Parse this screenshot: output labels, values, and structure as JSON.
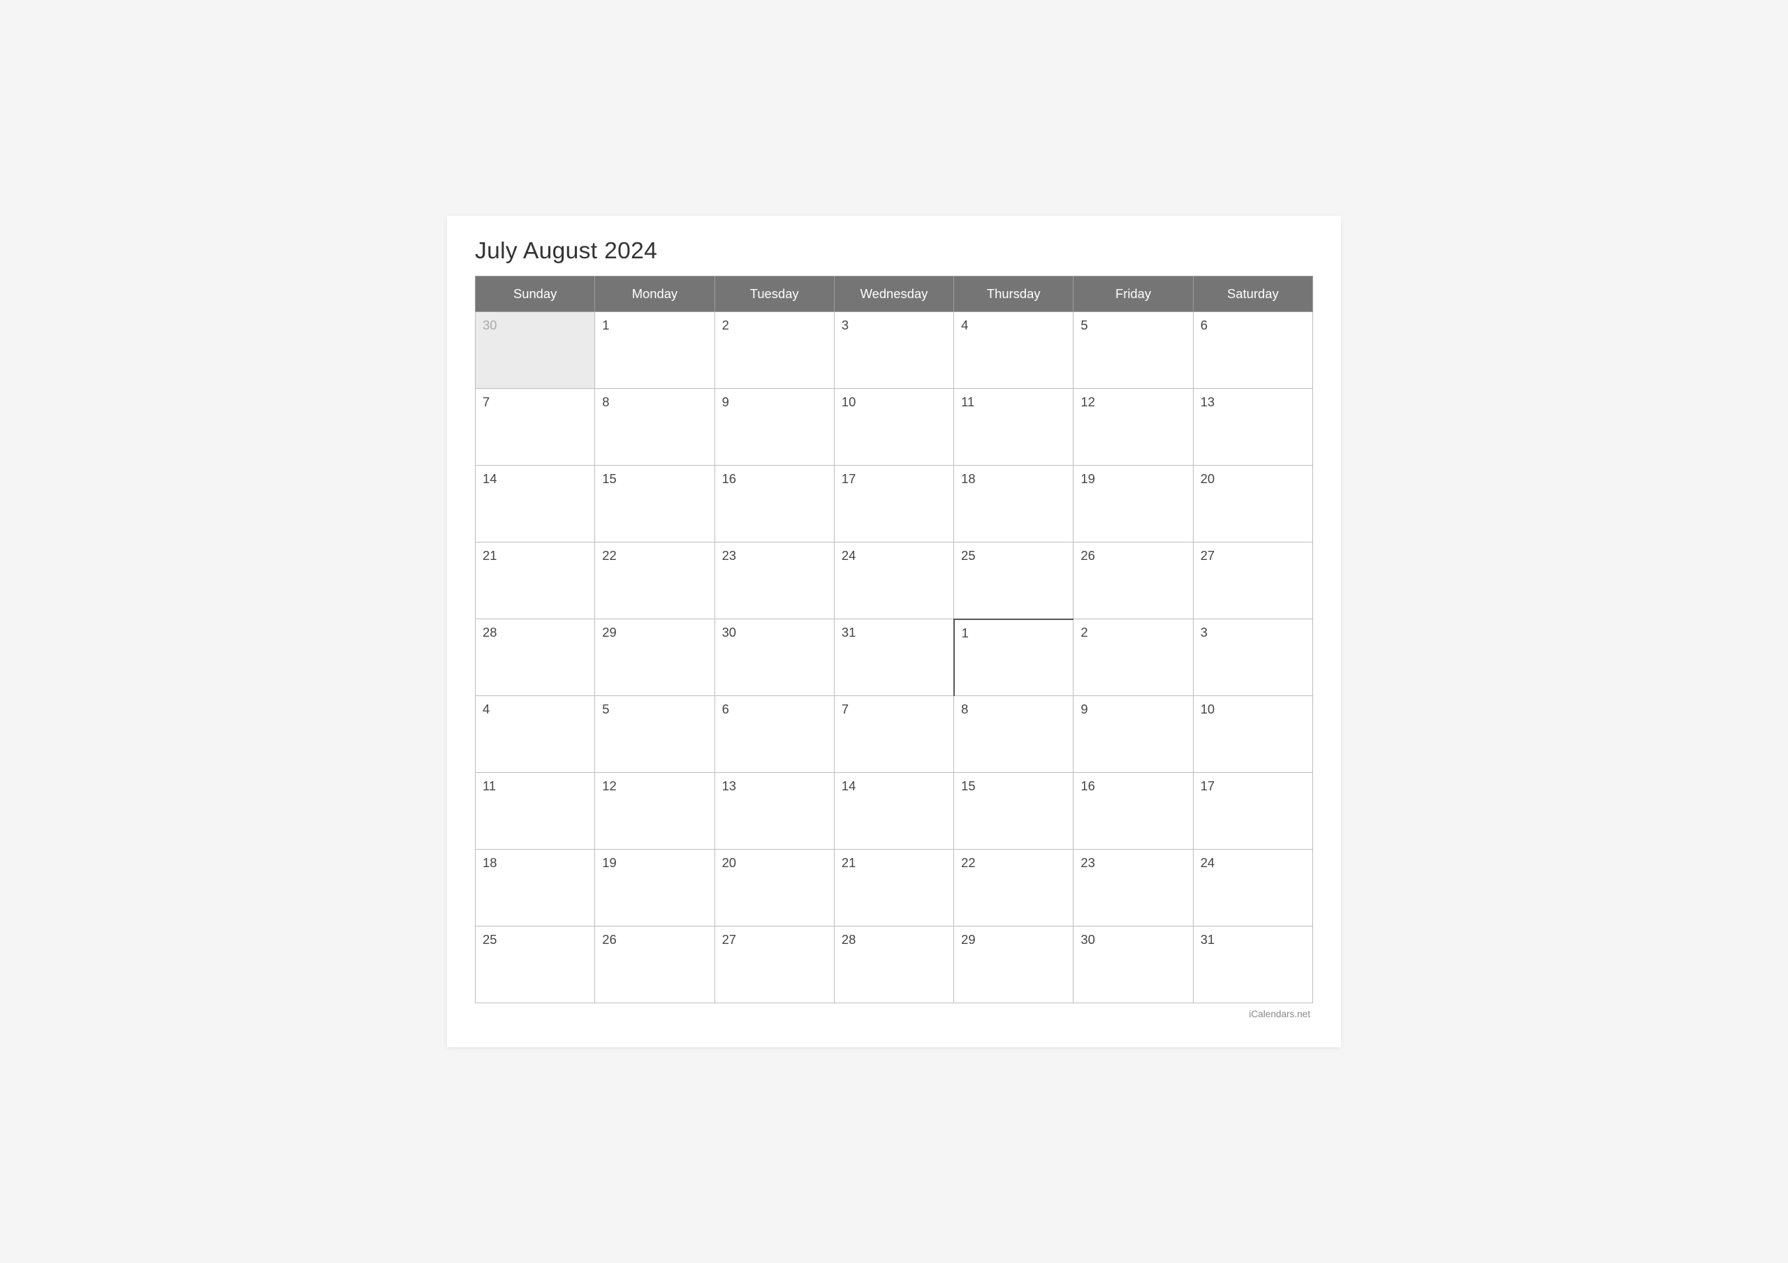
{
  "title": "July August 2024",
  "footer": "iCalendars.net",
  "header": {
    "days": [
      "Sunday",
      "Monday",
      "Tuesday",
      "Wednesday",
      "Thursday",
      "Friday",
      "Saturday"
    ]
  },
  "rows": [
    {
      "cells": [
        {
          "day": "30",
          "type": "prev-month"
        },
        {
          "day": "1",
          "type": "current-july"
        },
        {
          "day": "2",
          "type": "current-july"
        },
        {
          "day": "3",
          "type": "current-july"
        },
        {
          "day": "4",
          "type": "current-july"
        },
        {
          "day": "5",
          "type": "current-july"
        },
        {
          "day": "6",
          "type": "current-july"
        }
      ]
    },
    {
      "cells": [
        {
          "day": "7",
          "type": "current-july"
        },
        {
          "day": "8",
          "type": "current-july"
        },
        {
          "day": "9",
          "type": "current-july"
        },
        {
          "day": "10",
          "type": "current-july"
        },
        {
          "day": "11",
          "type": "current-july"
        },
        {
          "day": "12",
          "type": "current-july"
        },
        {
          "day": "13",
          "type": "current-july"
        }
      ]
    },
    {
      "cells": [
        {
          "day": "14",
          "type": "current-july"
        },
        {
          "day": "15",
          "type": "current-july"
        },
        {
          "day": "16",
          "type": "current-july"
        },
        {
          "day": "17",
          "type": "current-july"
        },
        {
          "day": "18",
          "type": "current-july"
        },
        {
          "day": "19",
          "type": "current-july"
        },
        {
          "day": "20",
          "type": "current-july"
        }
      ]
    },
    {
      "cells": [
        {
          "day": "21",
          "type": "current-july"
        },
        {
          "day": "22",
          "type": "current-july"
        },
        {
          "day": "23",
          "type": "current-july"
        },
        {
          "day": "24",
          "type": "current-july"
        },
        {
          "day": "25",
          "type": "current-july"
        },
        {
          "day": "26",
          "type": "current-july"
        },
        {
          "day": "27",
          "type": "current-july"
        }
      ]
    },
    {
      "cells": [
        {
          "day": "28",
          "type": "current-july"
        },
        {
          "day": "29",
          "type": "current-july"
        },
        {
          "day": "30",
          "type": "current-july"
        },
        {
          "day": "31",
          "type": "current-july",
          "divider-right": true
        },
        {
          "day": "1",
          "type": "current-august",
          "divider-left": true
        },
        {
          "day": "2",
          "type": "current-august"
        },
        {
          "day": "3",
          "type": "current-august"
        }
      ]
    },
    {
      "cells": [
        {
          "day": "4",
          "type": "current-august"
        },
        {
          "day": "5",
          "type": "current-august"
        },
        {
          "day": "6",
          "type": "current-august"
        },
        {
          "day": "7",
          "type": "current-august"
        },
        {
          "day": "8",
          "type": "current-august"
        },
        {
          "day": "9",
          "type": "current-august"
        },
        {
          "day": "10",
          "type": "current-august"
        }
      ]
    },
    {
      "cells": [
        {
          "day": "11",
          "type": "current-august"
        },
        {
          "day": "12",
          "type": "current-august"
        },
        {
          "day": "13",
          "type": "current-august"
        },
        {
          "day": "14",
          "type": "current-august"
        },
        {
          "day": "15",
          "type": "current-august"
        },
        {
          "day": "16",
          "type": "current-august"
        },
        {
          "day": "17",
          "type": "current-august"
        }
      ]
    },
    {
      "cells": [
        {
          "day": "18",
          "type": "current-august"
        },
        {
          "day": "19",
          "type": "current-august"
        },
        {
          "day": "20",
          "type": "current-august"
        },
        {
          "day": "21",
          "type": "current-august"
        },
        {
          "day": "22",
          "type": "current-august"
        },
        {
          "day": "23",
          "type": "current-august"
        },
        {
          "day": "24",
          "type": "current-august"
        }
      ]
    },
    {
      "cells": [
        {
          "day": "25",
          "type": "current-august"
        },
        {
          "day": "26",
          "type": "current-august"
        },
        {
          "day": "27",
          "type": "current-august"
        },
        {
          "day": "28",
          "type": "current-august"
        },
        {
          "day": "29",
          "type": "current-august"
        },
        {
          "day": "30",
          "type": "current-august"
        },
        {
          "day": "31",
          "type": "current-august"
        }
      ]
    }
  ]
}
